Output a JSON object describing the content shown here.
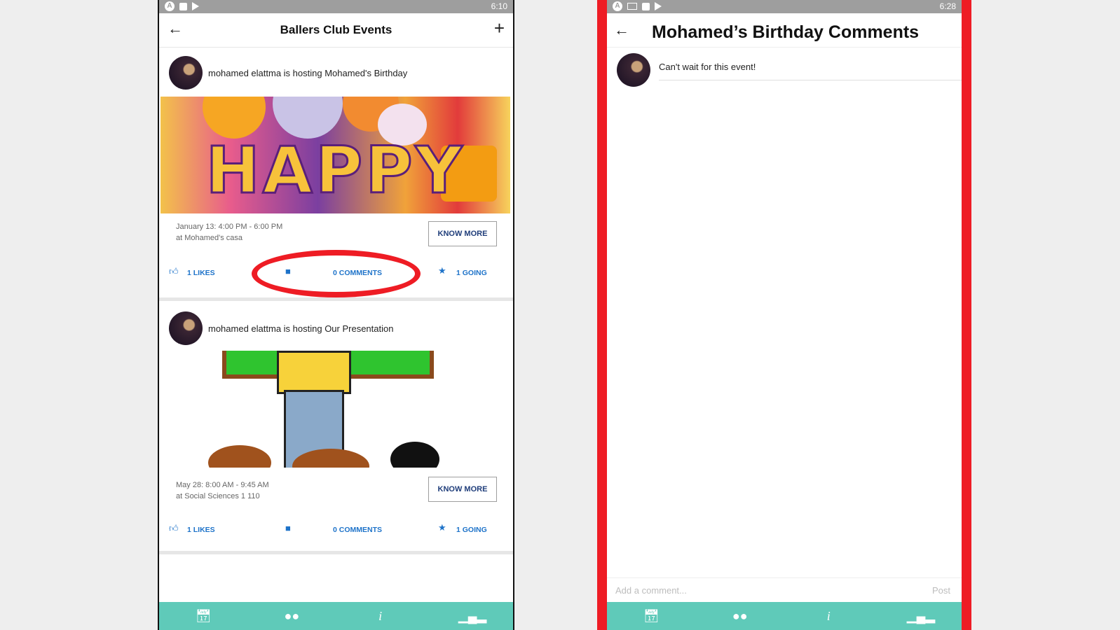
{
  "left": {
    "status_time": "6:10",
    "title": "Ballers Club Events",
    "events": [
      {
        "host": "mohamed elattma is hosting Mohamed's Birthday",
        "image_text": "HAPPY",
        "date": "January 13: 4:00 PM - 6:00 PM",
        "location": "at Mohamed's casa",
        "know_more": "KNOW MORE",
        "likes": "1 LIKES",
        "comments": "0 COMMENTS",
        "going": "1 GOING"
      },
      {
        "host": "mohamed elattma is hosting Our Presentation",
        "date": "May 28: 8:00 AM - 9:45 AM",
        "location": "at Social Sciences 1 110",
        "know_more": "KNOW MORE",
        "likes": "1 LIKES",
        "comments": "0 COMMENTS",
        "going": "1 GOING"
      }
    ]
  },
  "right": {
    "status_time": "6:28",
    "title": "Mohamed’s Birthday Comments",
    "comments": [
      {
        "text": "Can't wait for this event!"
      }
    ],
    "input_placeholder": "Add a comment...",
    "post_label": "Post"
  },
  "icons": {
    "back": "arrow-left-icon",
    "add": "plus-icon",
    "like": "thumbs-up-icon",
    "comment": "chat-bubble-icon",
    "going": "star-icon",
    "nav": [
      "calendar-icon",
      "chat-icon",
      "info-icon",
      "bar-chart-icon"
    ]
  },
  "colors": {
    "accent": "#1e73c9",
    "bottom_bar": "#5fcab9",
    "highlight": "#ee1c24",
    "status_bar": "#9e9e9e"
  }
}
